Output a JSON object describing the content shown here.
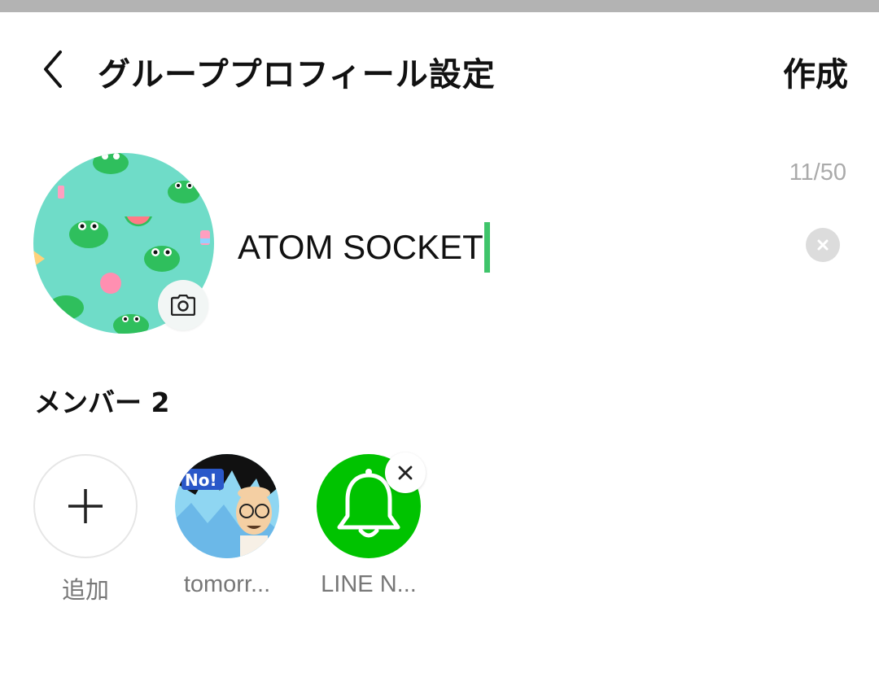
{
  "header": {
    "title": "グループプロフィール設定",
    "create_label": "作成"
  },
  "profile": {
    "char_count": "11/50",
    "name_value": "ATOM SOCKET"
  },
  "members": {
    "label": "メンバー 2",
    "items": [
      {
        "label": "追加",
        "icon": "plus-icon"
      },
      {
        "label": "tomorr...",
        "icon": "avatar"
      },
      {
        "label": "LINE N...",
        "icon": "bell-icon"
      }
    ]
  },
  "colors": {
    "accent": "#3fc46a",
    "line_green": "#00c300",
    "avatar_bg": "#6fdcc8"
  }
}
